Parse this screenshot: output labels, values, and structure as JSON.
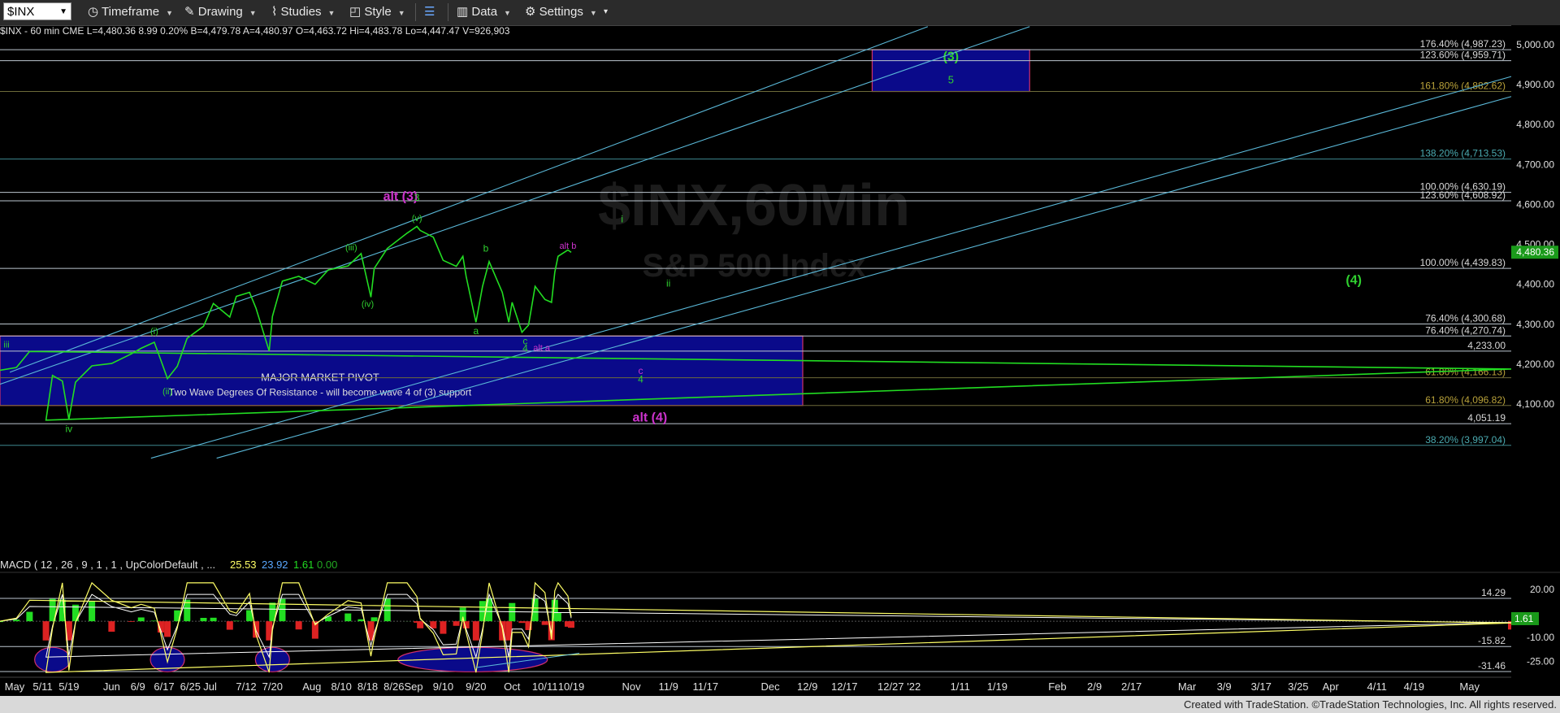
{
  "toolbar": {
    "symbol": "$INX",
    "timeframe_label": "Timeframe",
    "drawing_label": "Drawing",
    "studies_label": "Studies",
    "style_label": "Style",
    "data_label": "Data",
    "settings_label": "Settings"
  },
  "infobar": {
    "text": "$INX - 60 min  CME   L=4,480.36  8.99  0.20%  B=4,479.78  A=4,480.97  O=4,463.72  Hi=4,483.78  Lo=4,447.47  V=926,903"
  },
  "macd_header": {
    "label": "MACD ( 12 , 26 , 9 , 1 , 1 , UpColorDefault , ...",
    "v1": "25.53",
    "v2": "23.92",
    "v3": "1.61",
    "v4": "0.00"
  },
  "watermark": {
    "symbol": "$INX,60Min",
    "name": "S&P 500 Index"
  },
  "footer": {
    "text": "Created with TradeStation. ©TradeStation Technologies, Inc. All rights reserved."
  },
  "colors": {
    "price": "#22dd22",
    "fib_line": "#c8d0d8",
    "channel": "#5ab8d8",
    "fib_label_gold": "#b9a23a",
    "fib_label_teal": "#4aaab0",
    "wave_green": "#2fcf2f",
    "wave_magenta": "#cc33cc",
    "box_fill": "#0a0a8a",
    "box_border": "#d0306a",
    "macd_up": "#22dd22",
    "macd_down": "#dd2222",
    "macd_line": "#ffff66",
    "signal_line": "#ffffff"
  },
  "chart_data": {
    "type": "line",
    "symbol": "$INX",
    "interval": "60 min",
    "price_axis": {
      "ticks": [
        "5,000.00",
        "4,900.00",
        "4,800.00",
        "4,700.00",
        "4,600.00",
        "4,500.00",
        "4,400.00",
        "4,300.00",
        "4,200.00",
        "4,100.00"
      ],
      "range": [
        3960,
        5020
      ],
      "last_price_label": "4,480.36"
    },
    "date_axis": {
      "ticks": [
        "May",
        "5/11",
        "5/19",
        "Jun",
        "6/9",
        "6/17",
        "6/25",
        "Jul",
        "7/12",
        "7/20",
        "Aug",
        "8/10",
        "8/18",
        "8/26",
        "Sep",
        "9/10",
        "9/20",
        "Oct",
        "10/11",
        "10/19",
        "Nov",
        "11/9",
        "11/17",
        "Dec",
        "12/9",
        "12/17",
        "12/27",
        "'22",
        "1/11",
        "1/19",
        "Feb",
        "2/9",
        "2/17",
        "Mar",
        "3/9",
        "3/17",
        "3/25",
        "Apr",
        "4/11",
        "4/19",
        "May"
      ]
    },
    "price_series": {
      "name": "",
      "points": [
        [
          "Apr 28",
          4185
        ],
        [
          "May 3",
          4192
        ],
        [
          "May 7",
          4232
        ],
        [
          "May 10",
          4188
        ],
        [
          "May 12",
          4060
        ],
        [
          "May 14",
          4172
        ],
        [
          "May 17",
          4158
        ],
        [
          "May 19",
          4062
        ],
        [
          "May 21",
          4155
        ],
        [
          "May 26",
          4196
        ],
        [
          "Jun 1",
          4202
        ],
        [
          "Jun 7",
          4226
        ],
        [
          "Jun 10",
          4240
        ],
        [
          "Jun 14",
          4255
        ],
        [
          "Jun 16",
          4210
        ],
        [
          "Jun 18",
          4164
        ],
        [
          "Jun 21",
          4195
        ],
        [
          "Jun 24",
          4265
        ],
        [
          "Jun 29",
          4295
        ],
        [
          "Jul 2",
          4352
        ],
        [
          "Jul 7",
          4318
        ],
        [
          "Jul 9",
          4370
        ],
        [
          "Jul 13",
          4380
        ],
        [
          "Jul 15",
          4340
        ],
        [
          "Jul 19",
          4233
        ],
        [
          "Jul 20",
          4320
        ],
        [
          "Jul 23",
          4408
        ],
        [
          "Jul 28",
          4420
        ],
        [
          "Aug 2",
          4400
        ],
        [
          "Aug 6",
          4436
        ],
        [
          "Aug 12",
          4446
        ],
        [
          "Aug 16",
          4477
        ],
        [
          "Aug 19",
          4368
        ],
        [
          "Aug 20",
          4440
        ],
        [
          "Aug 24",
          4490
        ],
        [
          "Aug 30",
          4528
        ],
        [
          "Sep 2",
          4545
        ],
        [
          "Sep 3",
          4535
        ],
        [
          "Sep 7",
          4518
        ],
        [
          "Sep 10",
          4460
        ],
        [
          "Sep 14",
          4445
        ],
        [
          "Sep 16",
          4470
        ],
        [
          "Sep 17",
          4420
        ],
        [
          "Sep 20",
          4305
        ],
        [
          "Sep 22",
          4395
        ],
        [
          "Sep 24",
          4457
        ],
        [
          "Sep 28",
          4380
        ],
        [
          "Sep 30",
          4305
        ],
        [
          "Oct 1",
          4355
        ],
        [
          "Oct 4",
          4280
        ],
        [
          "Oct 6",
          4298
        ],
        [
          "Oct 8",
          4395
        ],
        [
          "Oct 11",
          4362
        ],
        [
          "Oct 13",
          4355
        ],
        [
          "Oct 14",
          4430
        ],
        [
          "Oct 15",
          4470
        ],
        [
          "Oct 18",
          4486
        ],
        [
          "Oct 19",
          4480
        ]
      ]
    },
    "fib_levels": [
      {
        "label": "176.40% (4,987.23)",
        "value": 4987.23,
        "label_color": "white"
      },
      {
        "label": "123.60% (4,959.71)",
        "value": 4959.71,
        "label_color": "white"
      },
      {
        "label": "161.80% (4,882.62)",
        "value": 4882.62,
        "label_color": "gold"
      },
      {
        "label": "138.20% (4,713.53)",
        "value": 4713.53,
        "label_color": "teal"
      },
      {
        "label": "100.00% (4,630.19)",
        "value": 4630.19,
        "label_color": "white"
      },
      {
        "label": "123.60% (4,608.92)",
        "value": 4608.92,
        "label_color": "white"
      },
      {
        "label": "100.00% (4,439.83)",
        "value": 4439.83,
        "label_color": "white"
      },
      {
        "label": "76.40% (4,300.68)",
        "value": 4300.68,
        "label_color": "white"
      },
      {
        "label": "76.40% (4,270.74)",
        "value": 4270.74,
        "label_color": "white"
      },
      {
        "label": "4,233.00",
        "value": 4233.0,
        "label_color": "white"
      },
      {
        "label": "61.80% (4,166.13)",
        "value": 4166.13,
        "label_color": "gold"
      },
      {
        "label": "61.80% (4,096.82)",
        "value": 4096.82,
        "label_color": "gold"
      },
      {
        "label": "4,051.19",
        "value": 4051.19,
        "label_color": "white"
      },
      {
        "label": "38.20% (3,997.04)",
        "value": 3997.04,
        "label_color": "teal"
      }
    ],
    "zones": [
      {
        "label": "MAJOR MARKET PIVOT",
        "sublabel": "Two Wave Degrees Of Resistance - will become wave 4 of (3) support",
        "from": "Apr 28",
        "to": "Dec 8",
        "low": 4096.82,
        "high": 4270.74
      },
      {
        "label": "(3)",
        "sublabel": "5",
        "from": "Dec 23",
        "to": "Jan 26",
        "low": 4882.62,
        "high": 4987.23
      }
    ],
    "channels": [
      {
        "from": [
          "May 1",
          4180
        ],
        "to": [
          "Jan 4",
          5045
        ]
      },
      {
        "from": [
          "Apr 28",
          4150
        ],
        "to": [
          "Jan 26",
          5045
        ]
      },
      {
        "from": [
          "Jun 13",
          3965
        ],
        "to": [
          "May 10",
          4920
        ]
      },
      {
        "from": [
          "Jul 3",
          3965
        ],
        "to": [
          "May 10",
          4870
        ]
      }
    ],
    "wave_labels": [
      {
        "text": "iii",
        "date": "Apr 30",
        "value": 4250,
        "color": "green"
      },
      {
        "text": "iv",
        "date": "May 19",
        "value": 4038,
        "color": "green"
      },
      {
        "text": "(i)",
        "date": "Jun 14",
        "value": 4283,
        "color": "green"
      },
      {
        "text": "(ii)",
        "date": "Jun 18",
        "value": 4133,
        "color": "green"
      },
      {
        "text": "(iii)",
        "date": "Aug 13",
        "value": 4493,
        "color": "green"
      },
      {
        "text": "(iv)",
        "date": "Aug 18",
        "value": 4352,
        "color": "green"
      },
      {
        "text": "alt (3)",
        "date": "Aug 28",
        "value": 4618,
        "color": "magenta"
      },
      {
        "text": "3",
        "date": "Sep 2",
        "value": 4617,
        "color": "green"
      },
      {
        "text": "(v)",
        "date": "Sep 2",
        "value": 4566,
        "color": "green"
      },
      {
        "text": "b",
        "date": "Sep 23",
        "value": 4490,
        "color": "green"
      },
      {
        "text": "a",
        "date": "Sep 20",
        "value": 4283,
        "color": "green"
      },
      {
        "text": "c",
        "date": "Oct 5",
        "value": 4258,
        "color": "green"
      },
      {
        "text": "4",
        "date": "Oct 5",
        "value": 4240,
        "color": "green"
      },
      {
        "text": "alt a",
        "date": "Oct 10",
        "value": 4242,
        "color": "magenta"
      },
      {
        "text": "alt b",
        "date": "Oct 18",
        "value": 4497,
        "color": "magenta"
      },
      {
        "text": "i",
        "date": "Oct 30",
        "value": 4563,
        "color": "green"
      },
      {
        "text": "ii",
        "date": "Nov 9",
        "value": 4403,
        "color": "green"
      },
      {
        "text": "c",
        "date": "Nov 3",
        "value": 4184,
        "color": "magenta"
      },
      {
        "text": "4",
        "date": "Nov 3",
        "value": 4162,
        "color": "green"
      },
      {
        "text": "alt (4)",
        "date": "Nov 5",
        "value": 4065,
        "color": "magenta"
      },
      {
        "text": "(4)",
        "date": "Apr 6",
        "value": 4409,
        "color": "green"
      }
    ],
    "macd": {
      "params": "12, 26, 9",
      "values": {
        "macd": 25.53,
        "signal": 23.92,
        "histogram": 1.61,
        "zero": 0.0
      },
      "axis_ticks": [
        "20.00",
        "-10.00",
        "-25.00"
      ],
      "levels": [
        {
          "label": "14.29",
          "value": 14.29
        },
        {
          "label": "-15.82",
          "value": -15.82
        },
        {
          "label": "-31.46",
          "value": -31.46
        }
      ],
      "last_label": "1.61",
      "range": [
        -34,
        26
      ]
    },
    "macd_ellipses": [
      {
        "date": "May 14",
        "value": -24
      },
      {
        "date": "Jun 18",
        "value": -24
      },
      {
        "date": "Jul 20",
        "value": -24
      },
      {
        "date": "Sep 19",
        "value": -24
      }
    ]
  }
}
